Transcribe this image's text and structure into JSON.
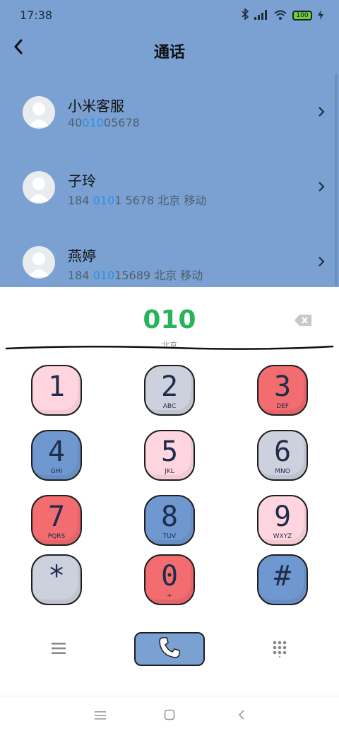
{
  "status": {
    "time": "17:38",
    "battery": "100"
  },
  "header": {
    "title": "通话"
  },
  "contacts": [
    {
      "name": "小米客服",
      "pre": "40",
      "hl": "010",
      "post": "05678"
    },
    {
      "name": "子玲",
      "pre": "184 ",
      "hl": "010",
      "post": "1 5678 北京 移动"
    },
    {
      "name": "燕婷",
      "pre": "184 ",
      "hl": "010",
      "post": "15689 北京 移动"
    }
  ],
  "dialer": {
    "number": "010",
    "city": "北京",
    "keys": [
      {
        "digit": "1",
        "letters": ""
      },
      {
        "digit": "2",
        "letters": "ABC"
      },
      {
        "digit": "3",
        "letters": "DEF"
      },
      {
        "digit": "4",
        "letters": "GHI"
      },
      {
        "digit": "5",
        "letters": "JKL"
      },
      {
        "digit": "6",
        "letters": "MNO"
      },
      {
        "digit": "7",
        "letters": "PQRS"
      },
      {
        "digit": "8",
        "letters": "TUV"
      },
      {
        "digit": "9",
        "letters": "WXYZ"
      },
      {
        "digit": "*",
        "letters": ""
      },
      {
        "digit": "0",
        "letters": "+"
      },
      {
        "digit": "#",
        "letters": ""
      }
    ]
  },
  "colors": {
    "header_bg": "#7aa1d2",
    "highlight": "#2a8fe8",
    "number": "#27b35a",
    "key_pink": "#ffd6df",
    "key_grey": "#ccd1dd",
    "key_red": "#f36c70",
    "key_blue": "#6f98d1"
  },
  "icons": {
    "back": "chevron-left-icon",
    "bluetooth": "bluetooth-icon",
    "signal": "signal-icon",
    "wifi": "wifi-icon",
    "charging": "bolt-icon",
    "delete": "backspace-icon",
    "menu": "menu-icon",
    "call": "phone-icon",
    "keypad": "dialpad-icon"
  }
}
